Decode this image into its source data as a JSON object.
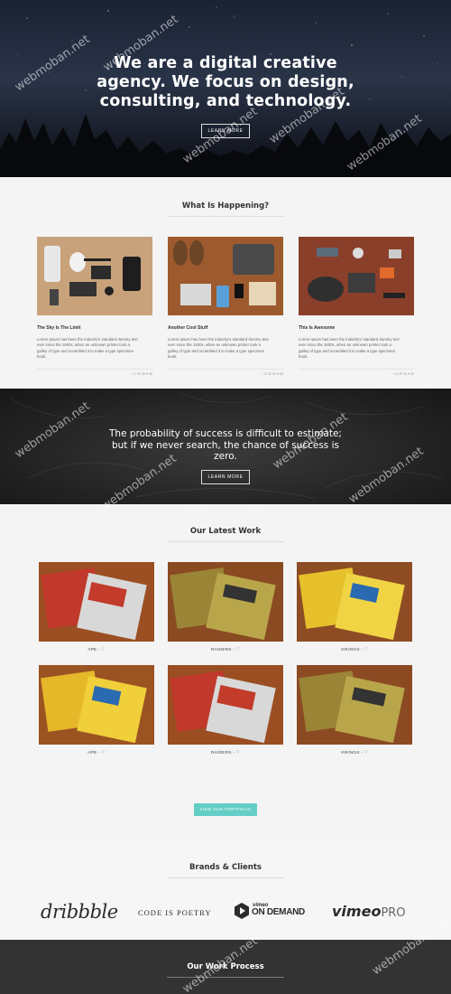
{
  "hero": {
    "title": "We are a digital creative agency. We focus on design, consulting, and technology.",
    "button_label": "LEARN MORE"
  },
  "news": {
    "section_title": "What Is Happening?",
    "cards": [
      {
        "title": "The Sky Is The Limit",
        "text": "Lorem Ipsum has been the industry's standard dummy text ever since the 1500s, when an unknown printer took a galley of type and scrambled it to make a type specimen book.",
        "meta": "♡ 17 ☰ 30 ♥ 98"
      },
      {
        "title": "Another Cool Stuff",
        "text": "Lorem Ipsum has been the industry's standard dummy text ever since the 1500s, when an unknown printer took a galley of type and scrambled it to make a type specimen book.",
        "meta": "♡ 12 ☰ 00 ♥ 00"
      },
      {
        "title": "This Is Awesome",
        "text": "Lorem Ipsum has been the industry's standard dummy text ever since the 1500s, when an unknown printer took a galley of type and scrambled it to make a type specimen book.",
        "meta": "♡ 12 ☰ 00 ♥ 00"
      }
    ]
  },
  "quote": {
    "text": "The probability of success is difficult to estimate; but if we never search, the chance of success is zero.",
    "button_label": "LEARN MORE"
  },
  "work": {
    "section_title": "Our Latest Work",
    "items": [
      {
        "label": "APE - ♡"
      },
      {
        "label": "RAIDERS - ♡"
      },
      {
        "label": "VIKINGS - ♡"
      },
      {
        "label": "APE - ♡"
      },
      {
        "label": "RAIDERS - ♡"
      },
      {
        "label": "VIKINGS - ♡"
      }
    ],
    "portfolio_button": "VIEW OUR PORTFOLIO",
    "accent_color": "#63cdc6"
  },
  "brands": {
    "section_title": "Brands & Clients",
    "logos": {
      "dribbble": "dribbble",
      "code_is_poetry": "CODE IS POETRY",
      "vod_small": "vimeo",
      "vod_big": "ON DEMAND",
      "vimeo": "vimeo",
      "vimeo_pro": "PRO"
    }
  },
  "process": {
    "section_title": "Our Work Process"
  },
  "watermark": "webmoban.net"
}
